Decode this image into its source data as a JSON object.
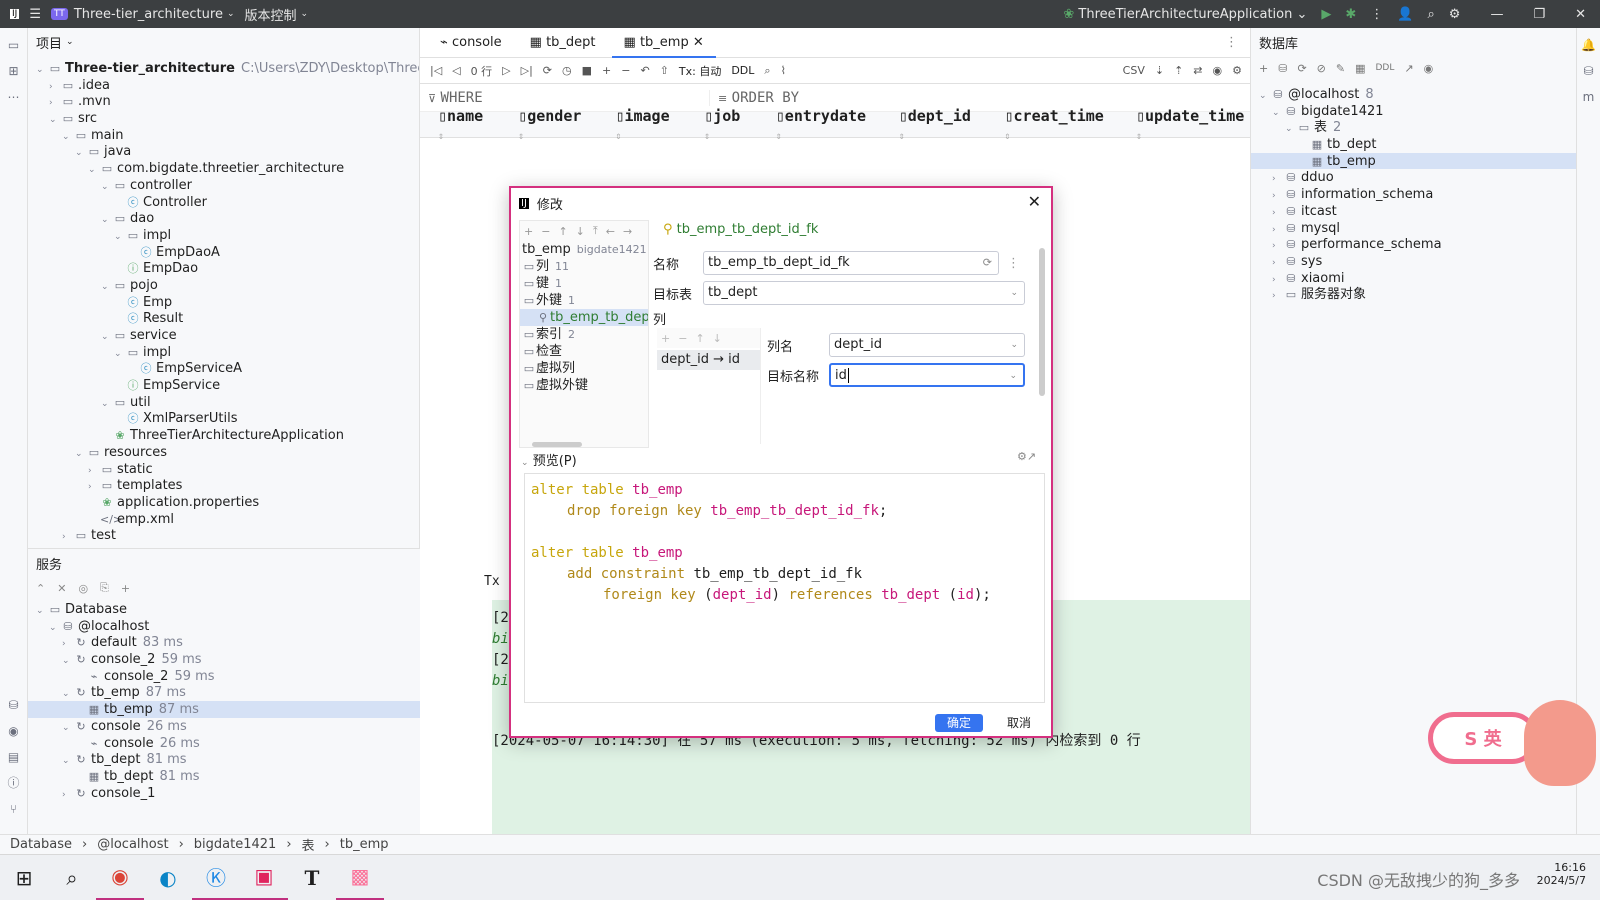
{
  "titlebar": {
    "project_badge": "TT",
    "project_name": "Three-tier_architecture",
    "vcs": "版本控制",
    "run_config": "ThreeTierArchitectureApplication"
  },
  "project_panel": {
    "header": "项目",
    "tree": [
      {
        "label": "Three-tier_architecture",
        "path": "C:\\Users\\ZDY\\Desktop\\Three-tie",
        "depth": 0,
        "type": "folder",
        "open": true,
        "bold": true
      },
      {
        "label": ".idea",
        "depth": 1,
        "type": "folder"
      },
      {
        "label": ".mvn",
        "depth": 1,
        "type": "folder"
      },
      {
        "label": "src",
        "depth": 1,
        "type": "folder",
        "open": true
      },
      {
        "label": "main",
        "depth": 2,
        "type": "folder",
        "open": true
      },
      {
        "label": "java",
        "depth": 3,
        "type": "folder",
        "open": true
      },
      {
        "label": "com.bigdate.threetier_architecture",
        "depth": 4,
        "type": "package",
        "open": true
      },
      {
        "label": "controller",
        "depth": 5,
        "type": "package",
        "open": true
      },
      {
        "label": "Controller",
        "depth": 6,
        "type": "class"
      },
      {
        "label": "dao",
        "depth": 5,
        "type": "package",
        "open": true
      },
      {
        "label": "impl",
        "depth": 6,
        "type": "package",
        "open": true
      },
      {
        "label": "EmpDaoA",
        "depth": 7,
        "type": "class"
      },
      {
        "label": "EmpDao",
        "depth": 6,
        "type": "interface"
      },
      {
        "label": "pojo",
        "depth": 5,
        "type": "package",
        "open": true
      },
      {
        "label": "Emp",
        "depth": 6,
        "type": "class"
      },
      {
        "label": "Result",
        "depth": 6,
        "type": "class"
      },
      {
        "label": "service",
        "depth": 5,
        "type": "package",
        "open": true
      },
      {
        "label": "impl",
        "depth": 6,
        "type": "package",
        "open": true
      },
      {
        "label": "EmpServiceA",
        "depth": 7,
        "type": "class"
      },
      {
        "label": "EmpService",
        "depth": 6,
        "type": "interface"
      },
      {
        "label": "util",
        "depth": 5,
        "type": "package",
        "open": true
      },
      {
        "label": "XmlParserUtils",
        "depth": 6,
        "type": "class"
      },
      {
        "label": "ThreeTierArchitectureApplication",
        "depth": 5,
        "type": "springapp"
      },
      {
        "label": "resources",
        "depth": 3,
        "type": "folder",
        "open": true
      },
      {
        "label": "static",
        "depth": 4,
        "type": "folder"
      },
      {
        "label": "templates",
        "depth": 4,
        "type": "folder"
      },
      {
        "label": "application.properties",
        "depth": 4,
        "type": "props"
      },
      {
        "label": "emp.xml",
        "depth": 4,
        "type": "xml"
      },
      {
        "label": "test",
        "depth": 2,
        "type": "folder"
      }
    ]
  },
  "services_panel": {
    "header": "服务",
    "tree": [
      {
        "label": "Database",
        "depth": 0,
        "type": "folder",
        "open": true
      },
      {
        "label": "@localhost",
        "depth": 1,
        "type": "datasource",
        "open": true
      },
      {
        "label": "default",
        "time": "83 ms",
        "depth": 2,
        "type": "session"
      },
      {
        "label": "console_2",
        "time": "59 ms",
        "depth": 2,
        "type": "session",
        "open": true
      },
      {
        "label": "console_2",
        "time": "59 ms",
        "depth": 3,
        "type": "console"
      },
      {
        "label": "tb_emp",
        "time": "87 ms",
        "depth": 2,
        "type": "session",
        "open": true
      },
      {
        "label": "tb_emp",
        "time": "87 ms",
        "depth": 3,
        "type": "table",
        "selected": true
      },
      {
        "label": "console",
        "time": "26 ms",
        "depth": 2,
        "type": "session",
        "open": true
      },
      {
        "label": "console",
        "time": "26 ms",
        "depth": 3,
        "type": "console"
      },
      {
        "label": "tb_dept",
        "time": "81 ms",
        "depth": 2,
        "type": "session",
        "open": true
      },
      {
        "label": "tb_dept",
        "time": "81 ms",
        "depth": 3,
        "type": "table"
      },
      {
        "label": "console_1",
        "depth": 2,
        "type": "session"
      }
    ]
  },
  "editor": {
    "tabs": [
      {
        "label": "console",
        "active": false
      },
      {
        "label": "tb_dept",
        "active": false
      },
      {
        "label": "tb_emp",
        "active": true
      }
    ],
    "toolbar": {
      "rows": "0 行",
      "tx": "Tx: 自动",
      "ddl": "DDL",
      "csv": "CSV"
    },
    "where": "WHERE",
    "order_by": "ORDER BY",
    "columns": [
      "name",
      "gender",
      "image",
      "job",
      "entrydate",
      "dept_id",
      "creat_time",
      "update_time"
    ],
    "tx_label": "Tx",
    "log_lines": [
      "[2",
      "bi",
      "[2",
      "bi"
    ],
    "log_full": "[2024-05-07 16:14:30] 在 57 ms (execution: 5 ms, fetching: 52 ms) 内检索到 0 行"
  },
  "db_panel": {
    "header": "数据库",
    "toolbar_ddl": "DDL",
    "tree": [
      {
        "label": "@localhost",
        "count": "8",
        "depth": 0,
        "open": true,
        "type": "datasource"
      },
      {
        "label": "bigdate1421",
        "depth": 1,
        "open": true,
        "type": "schema"
      },
      {
        "label": "表",
        "count": "2",
        "depth": 2,
        "open": true,
        "type": "folder"
      },
      {
        "label": "tb_dept",
        "depth": 3,
        "type": "table"
      },
      {
        "label": "tb_emp",
        "depth": 3,
        "type": "table",
        "selected": true
      },
      {
        "label": "dduo",
        "depth": 1,
        "type": "schema"
      },
      {
        "label": "information_schema",
        "depth": 1,
        "type": "schema"
      },
      {
        "label": "itcast",
        "depth": 1,
        "type": "schema"
      },
      {
        "label": "mysql",
        "depth": 1,
        "type": "schema"
      },
      {
        "label": "performance_schema",
        "depth": 1,
        "type": "schema"
      },
      {
        "label": "sys",
        "depth": 1,
        "type": "schema"
      },
      {
        "label": "xiaomi",
        "depth": 1,
        "type": "schema"
      },
      {
        "label": "服务器对象",
        "depth": 1,
        "type": "folder"
      }
    ]
  },
  "dialog": {
    "title": "修改",
    "fk_header": "tb_emp_tb_dept_id_fk",
    "tree_root": "tb_emp",
    "tree_root_schema": "bigdate1421 [",
    "tree": [
      {
        "label": "列",
        "count": "11"
      },
      {
        "label": "键",
        "count": "1"
      },
      {
        "label": "外键",
        "count": "1"
      },
      {
        "label": "tb_emp_tb_dept_",
        "count": "",
        "child": true,
        "selected": true
      },
      {
        "label": "索引",
        "count": "2"
      },
      {
        "label": "检查",
        "count": ""
      },
      {
        "label": "虚拟列",
        "count": ""
      },
      {
        "label": "虚拟外键",
        "count": ""
      }
    ],
    "name_label": "名称",
    "name_value": "tb_emp_tb_dept_id_fk",
    "target_table_label": "目标表",
    "target_table_value": "tb_dept",
    "columns_label": "列",
    "mapping": "dept_id → id",
    "col_name_label": "列名",
    "col_name_value": "dept_id",
    "target_name_label": "目标名称",
    "target_name_value": "id",
    "preview_label": "预览(P)",
    "sql": {
      "l1_kw": "alter table",
      "l1_id": "tb_emp",
      "l2_kw": "drop foreign key",
      "l2_id": "tb_emp_tb_dept_id_fk",
      "l2_end": ";",
      "l3_kw": "alter table",
      "l3_id": "tb_emp",
      "l4_kw": "add constraint",
      "l4_id": "tb_emp_tb_dept_id_fk",
      "l5_kw1": "foreign key",
      "l5_open": "(",
      "l5_col": "dept_id",
      "l5_close": ")",
      "l5_kw2": "references",
      "l5_tbl": "tb_dept",
      "l5_open2": "(",
      "l5_ref": "id",
      "l5_end": ");"
    },
    "ok": "确定",
    "cancel": "取消"
  },
  "breadcrumb": [
    "Database",
    "@localhost",
    "bigdate1421",
    "表",
    "tb_emp"
  ],
  "taskbar": {
    "time": "16:16",
    "date": "2024/5/7",
    "watermark": "CSDN @无敌拽少的狗_多多"
  },
  "mascot_text": "S 英"
}
